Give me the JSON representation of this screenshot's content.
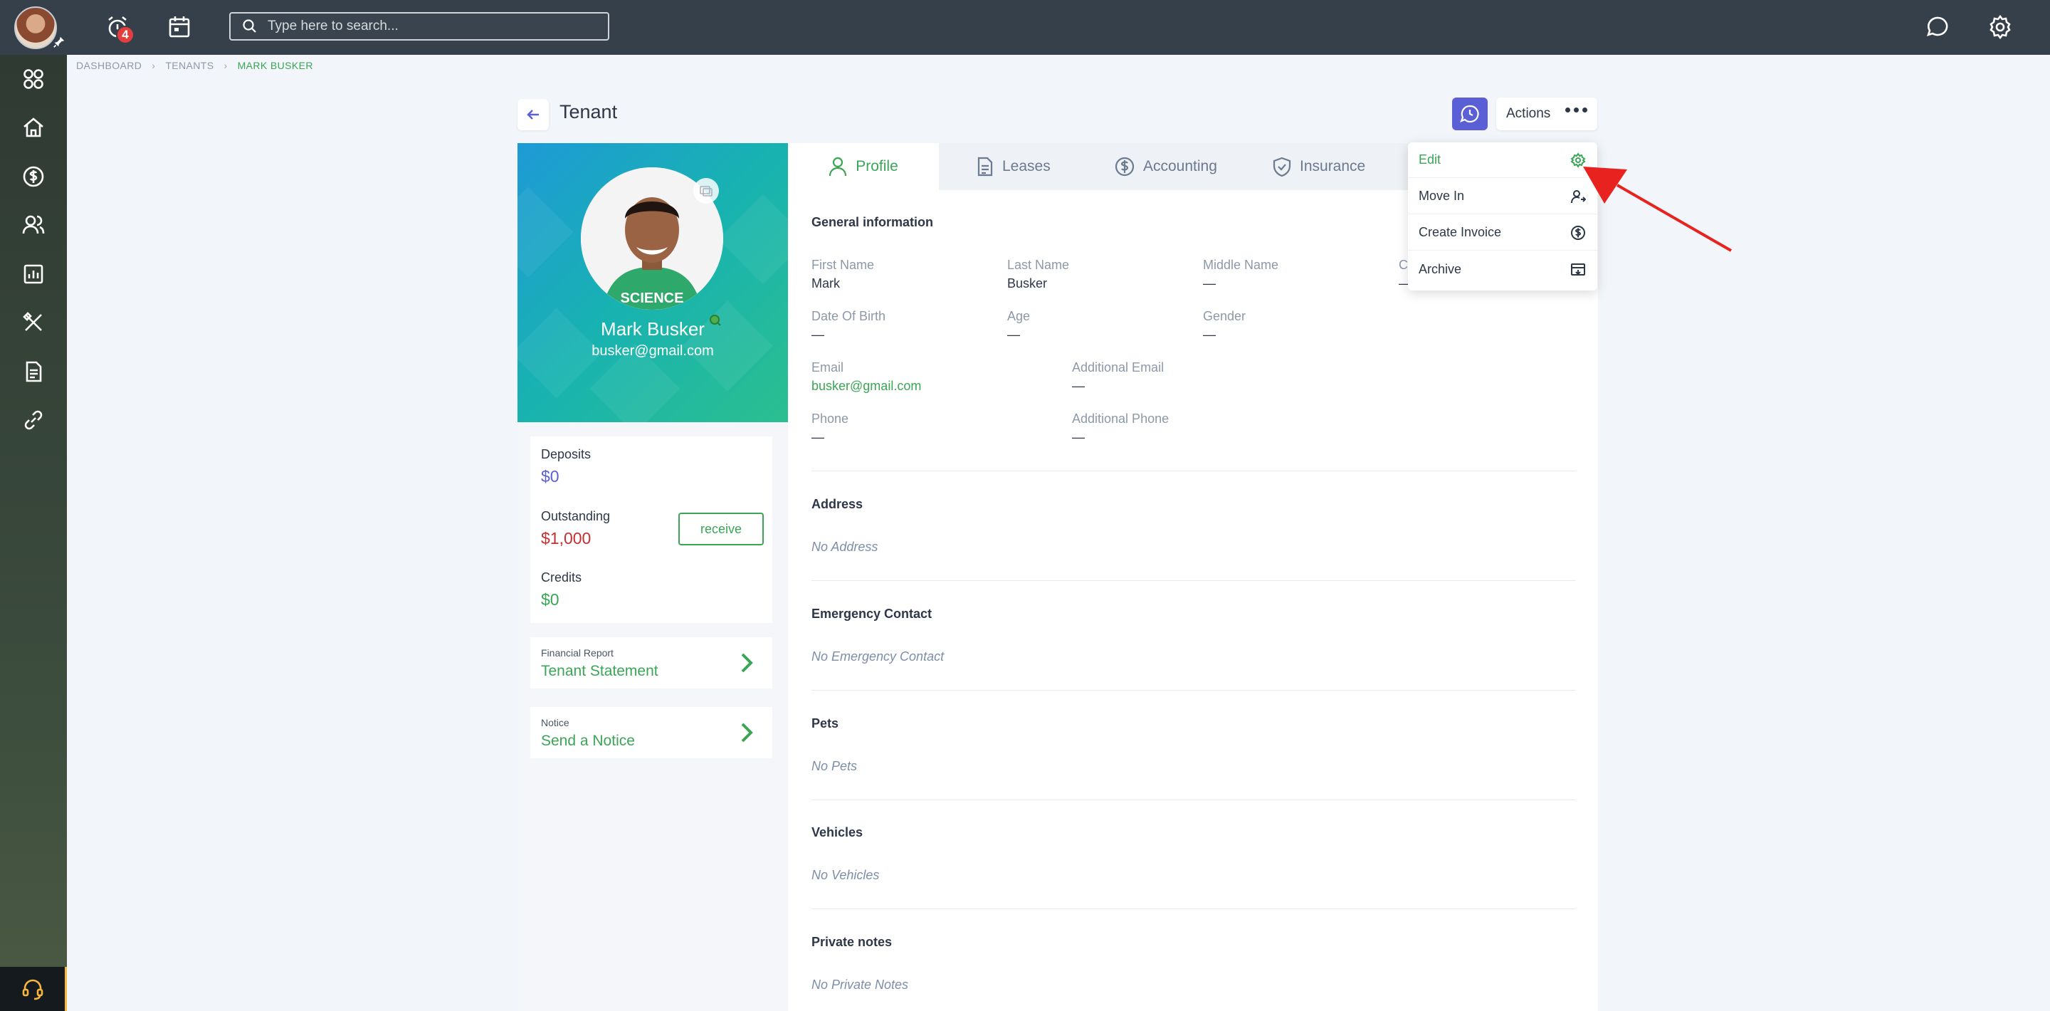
{
  "topbar": {
    "notification_count": "4",
    "search_placeholder": "Type here to search..."
  },
  "breadcrumb": {
    "items": [
      "DASHBOARD",
      "TENANTS",
      "MARK BUSKER"
    ]
  },
  "page": {
    "title": "Tenant",
    "actions_label": "Actions"
  },
  "profile": {
    "name": "Mark Busker",
    "email": "busker@gmail.com"
  },
  "finance": {
    "deposits_label": "Deposits",
    "deposits_value": "$0",
    "outstanding_label": "Outstanding",
    "outstanding_value": "$1,000",
    "receive_label": "receive",
    "credits_label": "Credits",
    "credits_value": "$0"
  },
  "links": [
    {
      "small": "Financial Report",
      "big": "Tenant Statement"
    },
    {
      "small": "Notice",
      "big": "Send a Notice"
    }
  ],
  "tabs": [
    {
      "label": "Profile",
      "active": true
    },
    {
      "label": "Leases"
    },
    {
      "label": "Accounting"
    },
    {
      "label": "Insurance"
    }
  ],
  "general": {
    "title": "General information",
    "first_name_label": "First Name",
    "first_name": "Mark",
    "last_name_label": "Last Name",
    "last_name": "Busker",
    "middle_name_label": "Middle Name",
    "middle_name": "—",
    "company_label": "C",
    "company": "—",
    "dob_label": "Date Of Birth",
    "dob": "—",
    "age_label": "Age",
    "age": "—",
    "gender_label": "Gender",
    "gender": "—",
    "email_label": "Email",
    "email": "busker@gmail.com",
    "add_email_label": "Additional Email",
    "add_email": "—",
    "phone_label": "Phone",
    "phone": "—",
    "add_phone_label": "Additional Phone",
    "add_phone": "—"
  },
  "sections": [
    {
      "title": "Address",
      "empty": "No Address"
    },
    {
      "title": "Emergency Contact",
      "empty": "No Emergency Contact"
    },
    {
      "title": "Pets",
      "empty": "No Pets"
    },
    {
      "title": "Vehicles",
      "empty": "No Vehicles"
    },
    {
      "title": "Private notes",
      "empty": "No Private Notes"
    }
  ],
  "dropdown": {
    "items": [
      "Edit",
      "Move In",
      "Create Invoice",
      "Archive"
    ]
  },
  "colors": {
    "accent_green": "#3aa655",
    "danger_red": "#c53030",
    "deposit_purple": "#5b5fd6",
    "annotation_arrow": "#e8231f"
  }
}
